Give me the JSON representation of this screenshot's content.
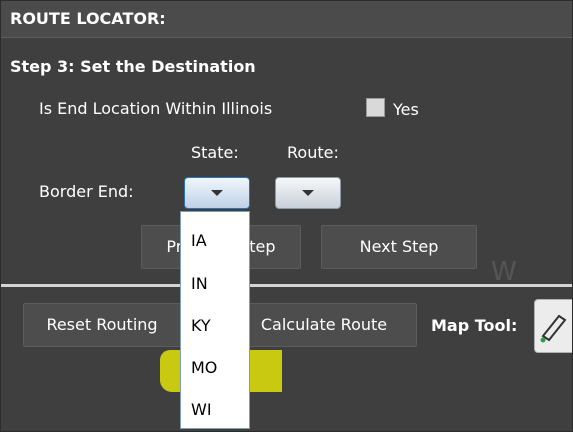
{
  "header": {
    "title": "ROUTE LOCATOR:"
  },
  "step": {
    "title": "Step 3:  Set the Destination"
  },
  "end_location": {
    "question": "Is End Location Within Illinois",
    "checkbox_label": "Yes",
    "checked": false
  },
  "columns": {
    "state": "State:",
    "route": "Route:"
  },
  "border_end": {
    "label": "Border End:"
  },
  "nav": {
    "previous_label": "Previous Step",
    "next_label": "Next Step"
  },
  "watermark": {
    "text": "W"
  },
  "bottom": {
    "reset_label": "Reset Routing",
    "calculate_label": "Calculate Route",
    "map_tool_label": "Map Tool:"
  },
  "state_dropdown": {
    "options": [
      "IA",
      "IN",
      "KY",
      "MO",
      "WI"
    ],
    "highlighted": "MO"
  },
  "colors": {
    "panel_bg": "#3f3f3f",
    "highlight": "#ffff00"
  }
}
